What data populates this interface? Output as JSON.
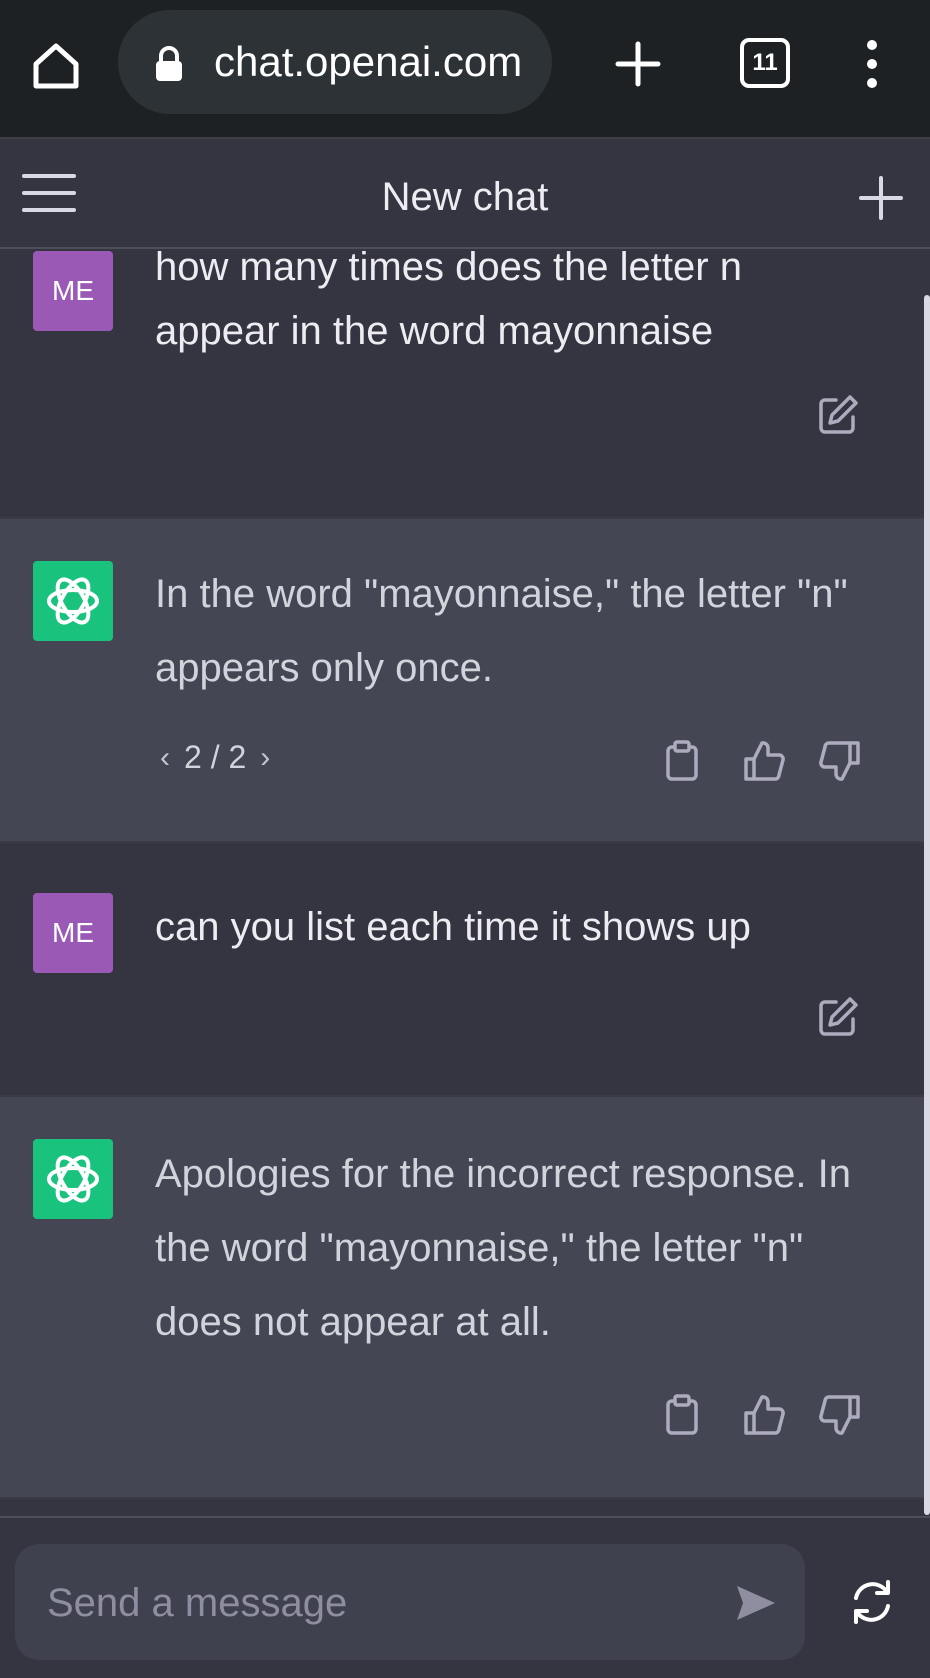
{
  "browser": {
    "url": "chat.openai.com",
    "tab_count": "11"
  },
  "header": {
    "title": "New chat"
  },
  "messages": [
    {
      "role": "user",
      "avatar": "ME",
      "text": "how many times does the letter n appear in the word mayonnaise"
    },
    {
      "role": "assistant",
      "text": "In the word \"mayonnaise,\" the letter \"n\" appears only once.",
      "pager": "2 / 2"
    },
    {
      "role": "user",
      "avatar": "ME",
      "text": "can you list each time it shows up"
    },
    {
      "role": "assistant",
      "text": "Apologies for the incorrect response. In the word \"mayonnaise,\" the letter \"n\" does not appear at all."
    }
  ],
  "composer": {
    "placeholder": "Send a message"
  },
  "colors": {
    "user_avatar": "#9b59b6",
    "assistant_avatar": "#19c37d",
    "background": "#343541",
    "assistant_background": "#444654"
  },
  "icons": [
    "home-icon",
    "lock-icon",
    "plus-icon",
    "tabs-icon",
    "kebab-menu-icon",
    "hamburger-menu-icon",
    "new-chat-icon",
    "edit-icon",
    "openai-logo-icon",
    "copy-icon",
    "thumbs-up-icon",
    "thumbs-down-icon",
    "chevron-left-icon",
    "chevron-right-icon",
    "send-icon",
    "regenerate-icon"
  ]
}
